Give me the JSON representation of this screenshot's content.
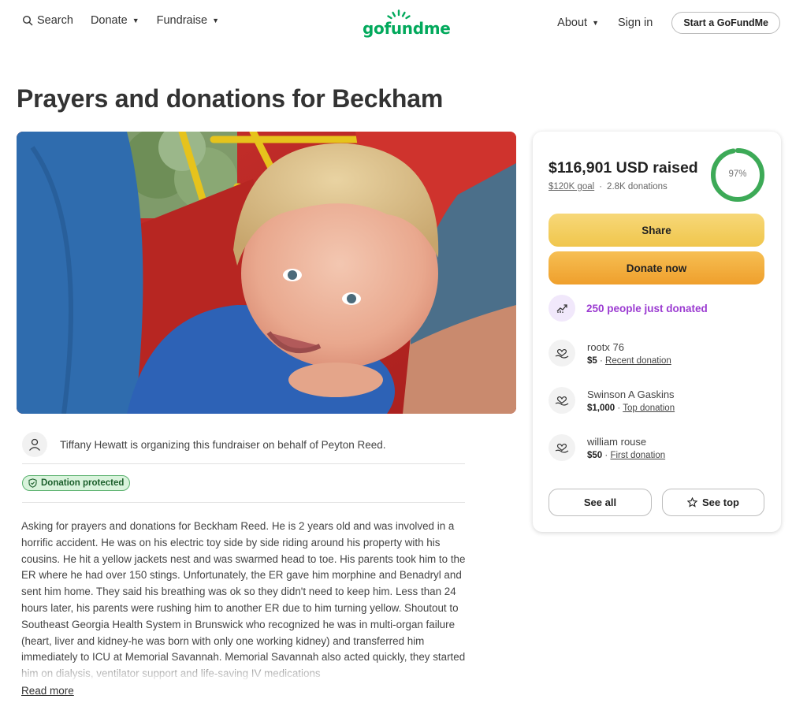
{
  "nav": {
    "search_label": "Search",
    "donate_label": "Donate",
    "fundraise_label": "Fundraise",
    "logo_text": "gofundme",
    "about_label": "About",
    "signin_label": "Sign in",
    "start_label": "Start a GoFundMe",
    "icons": [
      "search-icon",
      "caret-down-icon",
      "logo-sun-icon"
    ]
  },
  "campaign": {
    "title": "Prayers and donations for Beckham",
    "organizer_text": "Tiffany Hewatt is organizing this fundraiser on behalf of Peyton Reed.",
    "protected_badge": "Donation protected",
    "story": "Asking for prayers and donations for Beckham Reed. He is 2 years old and was involved in a horrific accident. He was on his electric toy side by side riding around his property with his cousins. He hit a yellow jackets nest and was swarmed head to toe. His parents took him to the ER where he had over 150 stings. Unfortunately, the ER gave him morphine and Benadryl and sent him home. They said his breathing was ok so they didn't need to keep him. Less than 24 hours later, his parents were rushing him to another ER due to him turning yellow. Shoutout to Southeast Georgia Health System in Brunswick who recognized he was in multi-organ failure (heart, liver and kidney-he was born with only one working kidney) and transferred him immediately to ICU at Memorial Savannah. Memorial Savannah also acted quickly, they started him on dialysis, ventilator support and life-saving IV medications",
    "read_more": "Read more"
  },
  "donation_card": {
    "raised": "$116,901 USD raised",
    "goal": "$120K goal",
    "separator": "·",
    "donation_count": "2.8K donations",
    "progress_percent_label": "97%",
    "progress_fraction": 0.97,
    "progress_color": "#3daa57",
    "share_label": "Share",
    "donate_label": "Donate now",
    "trend_text": "250 people just donated",
    "donors": [
      {
        "name": "rootx 76",
        "amount": "$5",
        "tag": "Recent donation"
      },
      {
        "name": "Swinson A Gaskins",
        "amount": "$1,000",
        "tag": "Top donation"
      },
      {
        "name": "william rouse",
        "amount": "$50",
        "tag": "First donation"
      }
    ],
    "see_all_label": "See all",
    "see_top_label": "See top"
  }
}
